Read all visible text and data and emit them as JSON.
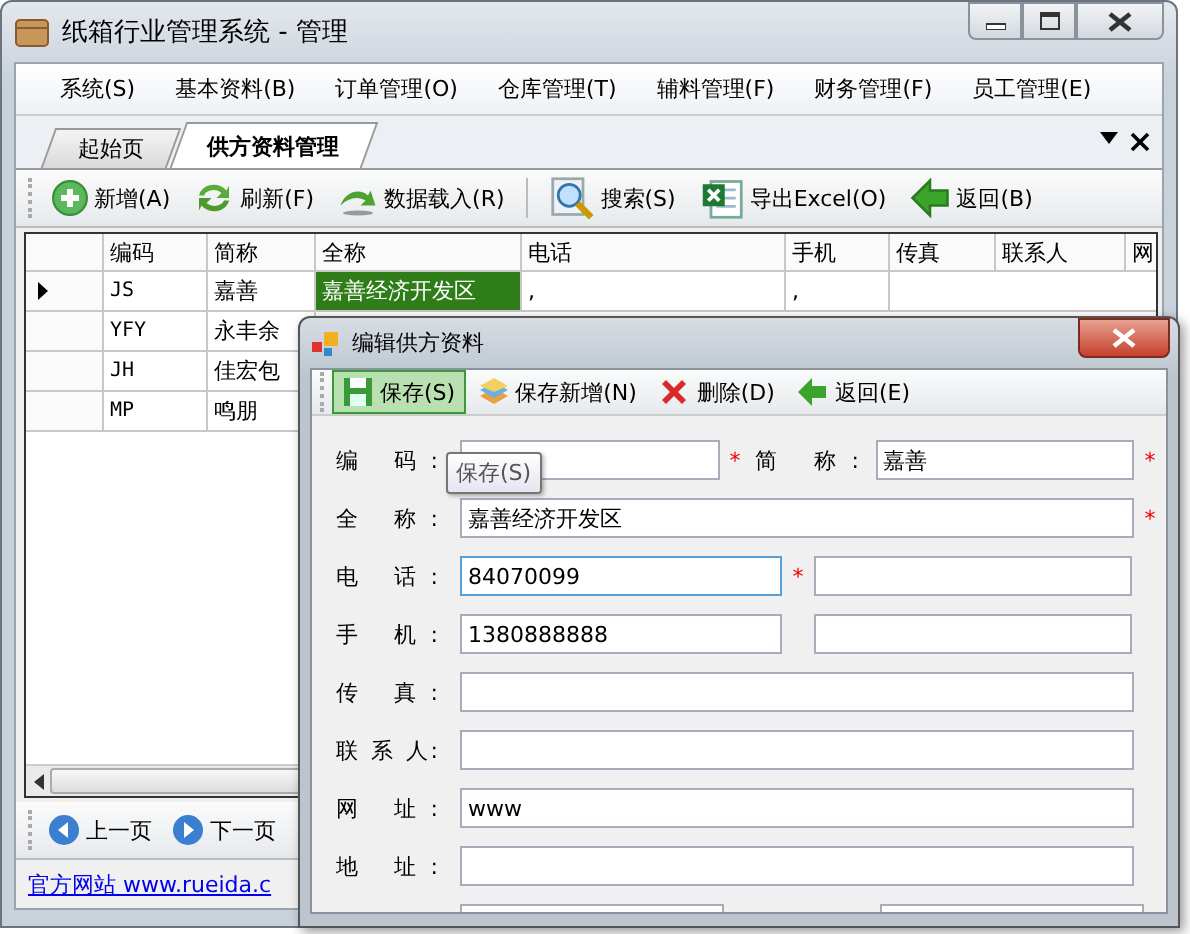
{
  "window": {
    "title": "纸箱行业管理系统 - 管理"
  },
  "menu": [
    "系统(S)",
    "基本资料(B)",
    "订单管理(O)",
    "仓库管理(T)",
    "辅料管理(F)",
    "财务管理(F)",
    "员工管理(E)"
  ],
  "tabs": [
    {
      "label": "起始页",
      "selected": false
    },
    {
      "label": "供方资料管理",
      "selected": true
    }
  ],
  "toolbar": {
    "groups": [
      [
        {
          "label": "新增(A)"
        },
        {
          "label": "刷新(F)"
        },
        {
          "label": "数据载入(R)"
        }
      ],
      [
        {
          "label": "搜索(S)"
        },
        {
          "label": "导出Excel(O)"
        },
        {
          "label": "返回(B)"
        }
      ]
    ]
  },
  "table": {
    "columns": [
      "编码",
      "简称",
      "全称",
      "电话",
      "手机",
      "传真",
      "联系人",
      "网"
    ],
    "rows": [
      {
        "selected": true,
        "cells": [
          {
            "text": "JS",
            "selected": false
          },
          {
            "text": "嘉善",
            "selected": false
          },
          {
            "text": "嘉善经济开发区",
            "selected": true
          },
          {
            "text": ",",
            "selected": false
          },
          {
            "text": ",",
            "selected": false
          }
        ]
      },
      {
        "selected": false,
        "cells": [
          {
            "text": "YFY",
            "selected": false
          },
          {
            "text": "永丰余",
            "selected": false
          }
        ]
      },
      {
        "selected": false,
        "cells": [
          {
            "text": "JH",
            "selected": false
          },
          {
            "text": "佳宏包",
            "selected": false
          }
        ]
      },
      {
        "selected": false,
        "cells": [
          {
            "text": "MP",
            "selected": false
          },
          {
            "text": "鸣朋",
            "selected": false
          }
        ]
      }
    ]
  },
  "pager": [
    "上一页",
    "下一页"
  ],
  "status_bar": {
    "link": "官方网站 www.rueida.c"
  },
  "dialog": {
    "title": "编辑供方资料",
    "toolbar": [
      {
        "label": "保存(S)",
        "highlighted": true
      },
      {
        "label": "保存新增(N)",
        "highlighted": false
      },
      {
        "label": "删除(D)",
        "highlighted": false
      },
      {
        "label": "返回(E)",
        "highlighted": false
      }
    ],
    "tooltip": "保存(S)",
    "rows": [
      {
        "kind": "labeled_pair",
        "label": "编 码:",
        "fields": [
          {
            "marker": "*",
            "focused": false
          },
          {
            "label": "简 称:",
            "value": "嘉善",
            "marker": "*",
            "focused": false
          }
        ]
      },
      {
        "kind": "single",
        "label": "全 称:",
        "fields": [
          {
            "value": "嘉善经济开发区",
            "marker": "*",
            "focused": false
          }
        ]
      },
      {
        "kind": "pair",
        "label": "电 话:",
        "fields": [
          {
            "value": "84070099",
            "marker": "*",
            "focused": true
          },
          {
            "focused": false
          }
        ]
      },
      {
        "kind": "pair",
        "label": "手 机:",
        "fields": [
          {
            "value": "1380888888",
            "focused": false
          },
          {
            "focused": false
          }
        ]
      },
      {
        "kind": "single",
        "label": "传 真:",
        "fields": [
          {
            "focused": false
          }
        ]
      },
      {
        "kind": "single",
        "label": "联 系 人:",
        "fields": [
          {
            "focused": false
          }
        ]
      },
      {
        "kind": "single",
        "label": "网 址:",
        "fields": [
          {
            "value": "www",
            "focused": false
          }
        ]
      },
      {
        "kind": "single",
        "label": "地 址:",
        "fields": [
          {
            "focused": false
          }
        ]
      },
      {
        "kind": "labeled_pair",
        "fields": [
          {
            "focused": false
          },
          {
            "focused": false
          }
        ]
      }
    ]
  }
}
